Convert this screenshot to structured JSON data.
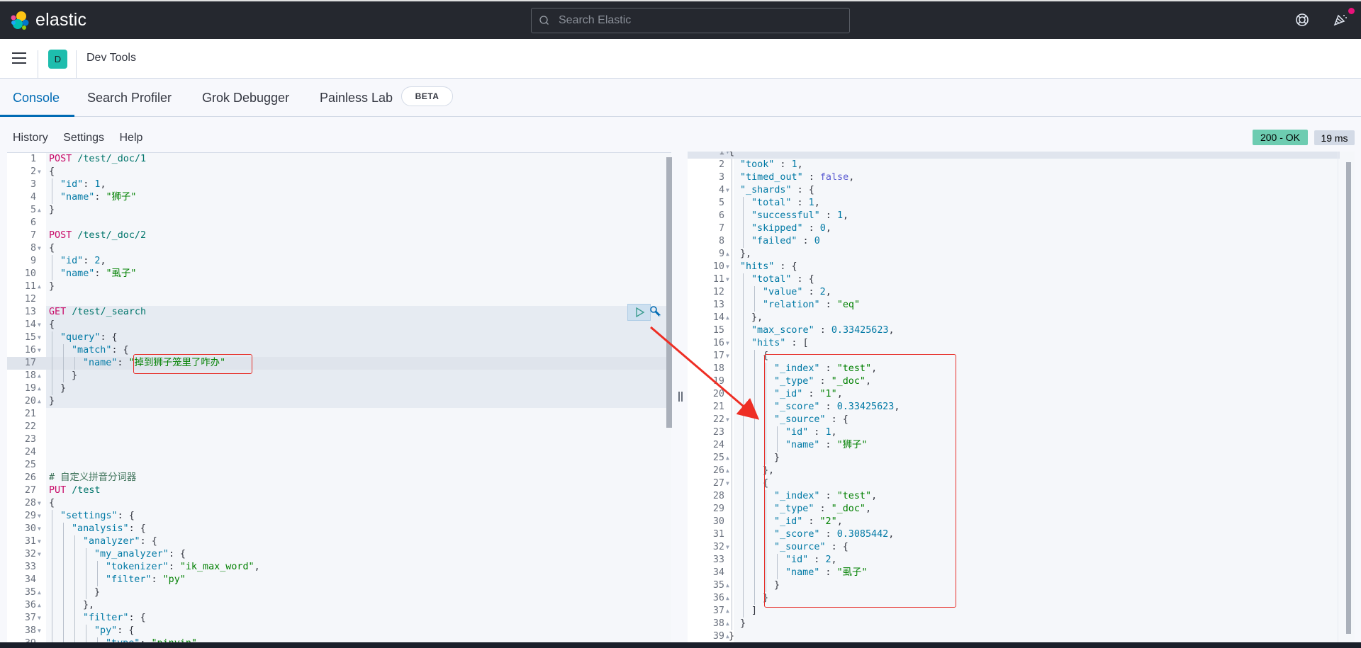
{
  "topbar": {
    "brand": "elastic",
    "search_placeholder": "Search Elastic",
    "icons": [
      "elastic-logo",
      "help-icon",
      "news-feed-icon"
    ]
  },
  "header": {
    "space_initial": "D",
    "title": "Dev Tools"
  },
  "tabs": [
    {
      "label": "Console",
      "active": true
    },
    {
      "label": "Search Profiler",
      "active": false
    },
    {
      "label": "Grok Debugger",
      "active": false
    },
    {
      "label": "Painless Lab",
      "active": false,
      "badge": "BETA"
    }
  ],
  "console_menu": [
    "History",
    "Settings",
    "Help"
  ],
  "status": {
    "code": "200 - OK",
    "time": "19 ms",
    "ok_color": "#6dccb1"
  },
  "request_editor": {
    "lines": [
      {
        "n": "1",
        "fold": "",
        "indent": 0,
        "tokens": [
          [
            "method",
            "POST"
          ],
          [
            "url",
            " /test/_doc/1"
          ]
        ]
      },
      {
        "n": "2",
        "fold": "down",
        "indent": 0,
        "tokens": [
          [
            "punc",
            "{"
          ]
        ]
      },
      {
        "n": "3",
        "fold": "",
        "indent": 1,
        "tokens": [
          [
            "key",
            "\"id\""
          ],
          [
            "punc",
            ": "
          ],
          [
            "num",
            "1"
          ],
          [
            "punc",
            ","
          ]
        ]
      },
      {
        "n": "4",
        "fold": "",
        "indent": 1,
        "tokens": [
          [
            "key",
            "\"name\""
          ],
          [
            "punc",
            ": "
          ],
          [
            "str",
            "\"狮子\""
          ]
        ]
      },
      {
        "n": "5",
        "fold": "up",
        "indent": 0,
        "tokens": [
          [
            "punc",
            "}"
          ]
        ]
      },
      {
        "n": "6",
        "fold": "",
        "indent": 0,
        "tokens": []
      },
      {
        "n": "7",
        "fold": "",
        "indent": 0,
        "tokens": [
          [
            "method",
            "POST"
          ],
          [
            "url",
            " /test/_doc/2"
          ]
        ]
      },
      {
        "n": "8",
        "fold": "down",
        "indent": 0,
        "tokens": [
          [
            "punc",
            "{"
          ]
        ]
      },
      {
        "n": "9",
        "fold": "",
        "indent": 1,
        "tokens": [
          [
            "key",
            "\"id\""
          ],
          [
            "punc",
            ": "
          ],
          [
            "num",
            "2"
          ],
          [
            "punc",
            ","
          ]
        ]
      },
      {
        "n": "10",
        "fold": "",
        "indent": 1,
        "tokens": [
          [
            "key",
            "\"name\""
          ],
          [
            "punc",
            ": "
          ],
          [
            "str",
            "\"虱子\""
          ]
        ]
      },
      {
        "n": "11",
        "fold": "up",
        "indent": 0,
        "tokens": [
          [
            "punc",
            "}"
          ]
        ]
      },
      {
        "n": "12",
        "fold": "",
        "indent": 0,
        "tokens": []
      },
      {
        "n": "13",
        "fold": "",
        "indent": 0,
        "tokens": [
          [
            "method",
            "GET"
          ],
          [
            "url",
            " /test/_search"
          ]
        ]
      },
      {
        "n": "14",
        "fold": "down",
        "indent": 0,
        "tokens": [
          [
            "punc",
            "{"
          ]
        ]
      },
      {
        "n": "15",
        "fold": "down",
        "indent": 1,
        "tokens": [
          [
            "key",
            "\"query\""
          ],
          [
            "punc",
            ": {"
          ]
        ]
      },
      {
        "n": "16",
        "fold": "down",
        "indent": 2,
        "tokens": [
          [
            "key",
            "\"match\""
          ],
          [
            "punc",
            ": {"
          ]
        ]
      },
      {
        "n": "17",
        "fold": "",
        "indent": 3,
        "tokens": [
          [
            "key",
            "\"name\""
          ],
          [
            "punc",
            ": "
          ],
          [
            "str",
            "\"掉到狮子笼里了咋办\""
          ]
        ]
      },
      {
        "n": "18",
        "fold": "up",
        "indent": 2,
        "tokens": [
          [
            "punc",
            "}"
          ]
        ]
      },
      {
        "n": "19",
        "fold": "up",
        "indent": 1,
        "tokens": [
          [
            "punc",
            "}"
          ]
        ]
      },
      {
        "n": "20",
        "fold": "up",
        "indent": 0,
        "tokens": [
          [
            "punc",
            "}"
          ]
        ]
      },
      {
        "n": "21",
        "fold": "",
        "indent": 0,
        "tokens": []
      },
      {
        "n": "22",
        "fold": "",
        "indent": 0,
        "tokens": []
      },
      {
        "n": "23",
        "fold": "",
        "indent": 0,
        "tokens": []
      },
      {
        "n": "24",
        "fold": "",
        "indent": 0,
        "tokens": []
      },
      {
        "n": "25",
        "fold": "",
        "indent": 0,
        "tokens": []
      },
      {
        "n": "26",
        "fold": "",
        "indent": 0,
        "tokens": [
          [
            "comment",
            "# 自定义拼音分词器"
          ]
        ]
      },
      {
        "n": "27",
        "fold": "",
        "indent": 0,
        "tokens": [
          [
            "method",
            "PUT"
          ],
          [
            "url",
            " /test"
          ]
        ]
      },
      {
        "n": "28",
        "fold": "down",
        "indent": 0,
        "tokens": [
          [
            "punc",
            "{"
          ]
        ]
      },
      {
        "n": "29",
        "fold": "down",
        "indent": 1,
        "tokens": [
          [
            "key",
            "\"settings\""
          ],
          [
            "punc",
            ": {"
          ]
        ]
      },
      {
        "n": "30",
        "fold": "down",
        "indent": 2,
        "tokens": [
          [
            "key",
            "\"analysis\""
          ],
          [
            "punc",
            ": {"
          ]
        ]
      },
      {
        "n": "31",
        "fold": "down",
        "indent": 3,
        "tokens": [
          [
            "key",
            "\"analyzer\""
          ],
          [
            "punc",
            ": {"
          ]
        ]
      },
      {
        "n": "32",
        "fold": "down",
        "indent": 4,
        "tokens": [
          [
            "key",
            "\"my_analyzer\""
          ],
          [
            "punc",
            ": {"
          ]
        ]
      },
      {
        "n": "33",
        "fold": "",
        "indent": 5,
        "tokens": [
          [
            "key",
            "\"tokenizer\""
          ],
          [
            "punc",
            ": "
          ],
          [
            "str",
            "\"ik_max_word\""
          ],
          [
            "punc",
            ","
          ]
        ]
      },
      {
        "n": "34",
        "fold": "",
        "indent": 5,
        "tokens": [
          [
            "key",
            "\"filter\""
          ],
          [
            "punc",
            ": "
          ],
          [
            "str",
            "\"py\""
          ]
        ]
      },
      {
        "n": "35",
        "fold": "up",
        "indent": 4,
        "tokens": [
          [
            "punc",
            "}"
          ]
        ]
      },
      {
        "n": "36",
        "fold": "up",
        "indent": 3,
        "tokens": [
          [
            "punc",
            "},"
          ]
        ]
      },
      {
        "n": "37",
        "fold": "down",
        "indent": 3,
        "tokens": [
          [
            "key",
            "\"filter\""
          ],
          [
            "punc",
            ": {"
          ]
        ]
      },
      {
        "n": "38",
        "fold": "down",
        "indent": 4,
        "tokens": [
          [
            "key",
            "\"py\""
          ],
          [
            "punc",
            ": {"
          ]
        ]
      },
      {
        "n": "39",
        "fold": "",
        "indent": 5,
        "tokens": [
          [
            "key",
            "\"type\""
          ],
          [
            "punc",
            ": "
          ],
          [
            "str",
            "\"pinyin\""
          ]
        ]
      }
    ]
  },
  "response_output": {
    "lines": [
      {
        "n": "1",
        "fold": "down",
        "indent": 0,
        "tokens": [
          [
            "punc",
            "{"
          ]
        ]
      },
      {
        "n": "2",
        "fold": "",
        "indent": 1,
        "tokens": [
          [
            "key",
            "\"took\""
          ],
          [
            "punc",
            " : "
          ],
          [
            "num",
            "1"
          ],
          [
            "punc",
            ","
          ]
        ]
      },
      {
        "n": "3",
        "fold": "",
        "indent": 1,
        "tokens": [
          [
            "key",
            "\"timed_out\""
          ],
          [
            "punc",
            " : "
          ],
          [
            "bool",
            "false"
          ],
          [
            "punc",
            ","
          ]
        ]
      },
      {
        "n": "4",
        "fold": "down",
        "indent": 1,
        "tokens": [
          [
            "key",
            "\"_shards\""
          ],
          [
            "punc",
            " : {"
          ]
        ]
      },
      {
        "n": "5",
        "fold": "",
        "indent": 2,
        "tokens": [
          [
            "key",
            "\"total\""
          ],
          [
            "punc",
            " : "
          ],
          [
            "num",
            "1"
          ],
          [
            "punc",
            ","
          ]
        ]
      },
      {
        "n": "6",
        "fold": "",
        "indent": 2,
        "tokens": [
          [
            "key",
            "\"successful\""
          ],
          [
            "punc",
            " : "
          ],
          [
            "num",
            "1"
          ],
          [
            "punc",
            ","
          ]
        ]
      },
      {
        "n": "7",
        "fold": "",
        "indent": 2,
        "tokens": [
          [
            "key",
            "\"skipped\""
          ],
          [
            "punc",
            " : "
          ],
          [
            "num",
            "0"
          ],
          [
            "punc",
            ","
          ]
        ]
      },
      {
        "n": "8",
        "fold": "",
        "indent": 2,
        "tokens": [
          [
            "key",
            "\"failed\""
          ],
          [
            "punc",
            " : "
          ],
          [
            "num",
            "0"
          ]
        ]
      },
      {
        "n": "9",
        "fold": "up",
        "indent": 1,
        "tokens": [
          [
            "punc",
            "},"
          ]
        ]
      },
      {
        "n": "10",
        "fold": "down",
        "indent": 1,
        "tokens": [
          [
            "key",
            "\"hits\""
          ],
          [
            "punc",
            " : {"
          ]
        ]
      },
      {
        "n": "11",
        "fold": "down",
        "indent": 2,
        "tokens": [
          [
            "key",
            "\"total\""
          ],
          [
            "punc",
            " : {"
          ]
        ]
      },
      {
        "n": "12",
        "fold": "",
        "indent": 3,
        "tokens": [
          [
            "key",
            "\"value\""
          ],
          [
            "punc",
            " : "
          ],
          [
            "num",
            "2"
          ],
          [
            "punc",
            ","
          ]
        ]
      },
      {
        "n": "13",
        "fold": "",
        "indent": 3,
        "tokens": [
          [
            "key",
            "\"relation\""
          ],
          [
            "punc",
            " : "
          ],
          [
            "str",
            "\"eq\""
          ]
        ]
      },
      {
        "n": "14",
        "fold": "up",
        "indent": 2,
        "tokens": [
          [
            "punc",
            "},"
          ]
        ]
      },
      {
        "n": "15",
        "fold": "",
        "indent": 2,
        "tokens": [
          [
            "key",
            "\"max_score\""
          ],
          [
            "punc",
            " : "
          ],
          [
            "num",
            "0.33425623"
          ],
          [
            "punc",
            ","
          ]
        ]
      },
      {
        "n": "16",
        "fold": "down",
        "indent": 2,
        "tokens": [
          [
            "key",
            "\"hits\""
          ],
          [
            "punc",
            " : ["
          ]
        ]
      },
      {
        "n": "17",
        "fold": "down",
        "indent": 3,
        "tokens": [
          [
            "punc",
            "{"
          ]
        ]
      },
      {
        "n": "18",
        "fold": "",
        "indent": 4,
        "tokens": [
          [
            "key",
            "\"_index\""
          ],
          [
            "punc",
            " : "
          ],
          [
            "str",
            "\"test\""
          ],
          [
            "punc",
            ","
          ]
        ]
      },
      {
        "n": "19",
        "fold": "",
        "indent": 4,
        "tokens": [
          [
            "key",
            "\"_type\""
          ],
          [
            "punc",
            " : "
          ],
          [
            "str",
            "\"_doc\""
          ],
          [
            "punc",
            ","
          ]
        ]
      },
      {
        "n": "20",
        "fold": "",
        "indent": 4,
        "tokens": [
          [
            "key",
            "\"_id\""
          ],
          [
            "punc",
            " : "
          ],
          [
            "str",
            "\"1\""
          ],
          [
            "punc",
            ","
          ]
        ]
      },
      {
        "n": "21",
        "fold": "",
        "indent": 4,
        "tokens": [
          [
            "key",
            "\"_score\""
          ],
          [
            "punc",
            " : "
          ],
          [
            "num",
            "0.33425623"
          ],
          [
            "punc",
            ","
          ]
        ]
      },
      {
        "n": "22",
        "fold": "down",
        "indent": 4,
        "tokens": [
          [
            "key",
            "\"_source\""
          ],
          [
            "punc",
            " : {"
          ]
        ]
      },
      {
        "n": "23",
        "fold": "",
        "indent": 5,
        "tokens": [
          [
            "key",
            "\"id\""
          ],
          [
            "punc",
            " : "
          ],
          [
            "num",
            "1"
          ],
          [
            "punc",
            ","
          ]
        ]
      },
      {
        "n": "24",
        "fold": "",
        "indent": 5,
        "tokens": [
          [
            "key",
            "\"name\""
          ],
          [
            "punc",
            " : "
          ],
          [
            "str",
            "\"狮子\""
          ]
        ]
      },
      {
        "n": "25",
        "fold": "up",
        "indent": 4,
        "tokens": [
          [
            "punc",
            "}"
          ]
        ]
      },
      {
        "n": "26",
        "fold": "up",
        "indent": 3,
        "tokens": [
          [
            "punc",
            "},"
          ]
        ]
      },
      {
        "n": "27",
        "fold": "down",
        "indent": 3,
        "tokens": [
          [
            "punc",
            "{"
          ]
        ]
      },
      {
        "n": "28",
        "fold": "",
        "indent": 4,
        "tokens": [
          [
            "key",
            "\"_index\""
          ],
          [
            "punc",
            " : "
          ],
          [
            "str",
            "\"test\""
          ],
          [
            "punc",
            ","
          ]
        ]
      },
      {
        "n": "29",
        "fold": "",
        "indent": 4,
        "tokens": [
          [
            "key",
            "\"_type\""
          ],
          [
            "punc",
            " : "
          ],
          [
            "str",
            "\"_doc\""
          ],
          [
            "punc",
            ","
          ]
        ]
      },
      {
        "n": "30",
        "fold": "",
        "indent": 4,
        "tokens": [
          [
            "key",
            "\"_id\""
          ],
          [
            "punc",
            " : "
          ],
          [
            "str",
            "\"2\""
          ],
          [
            "punc",
            ","
          ]
        ]
      },
      {
        "n": "31",
        "fold": "",
        "indent": 4,
        "tokens": [
          [
            "key",
            "\"_score\""
          ],
          [
            "punc",
            " : "
          ],
          [
            "num",
            "0.3085442"
          ],
          [
            "punc",
            ","
          ]
        ]
      },
      {
        "n": "32",
        "fold": "down",
        "indent": 4,
        "tokens": [
          [
            "key",
            "\"_source\""
          ],
          [
            "punc",
            " : {"
          ]
        ]
      },
      {
        "n": "33",
        "fold": "",
        "indent": 5,
        "tokens": [
          [
            "key",
            "\"id\""
          ],
          [
            "punc",
            " : "
          ],
          [
            "num",
            "2"
          ],
          [
            "punc",
            ","
          ]
        ]
      },
      {
        "n": "34",
        "fold": "",
        "indent": 5,
        "tokens": [
          [
            "key",
            "\"name\""
          ],
          [
            "punc",
            " : "
          ],
          [
            "str",
            "\"虱子\""
          ]
        ]
      },
      {
        "n": "35",
        "fold": "up",
        "indent": 4,
        "tokens": [
          [
            "punc",
            "}"
          ]
        ]
      },
      {
        "n": "36",
        "fold": "up",
        "indent": 3,
        "tokens": [
          [
            "punc",
            "}"
          ]
        ]
      },
      {
        "n": "37",
        "fold": "up",
        "indent": 2,
        "tokens": [
          [
            "punc",
            "]"
          ]
        ]
      },
      {
        "n": "38",
        "fold": "up",
        "indent": 1,
        "tokens": [
          [
            "punc",
            "}"
          ]
        ]
      },
      {
        "n": "39",
        "fold": "up",
        "indent": 0,
        "tokens": [
          [
            "punc",
            "}"
          ]
        ]
      }
    ]
  },
  "annotation": {
    "color": "#e7302a",
    "description": "arrow from query value box to hits results box"
  }
}
